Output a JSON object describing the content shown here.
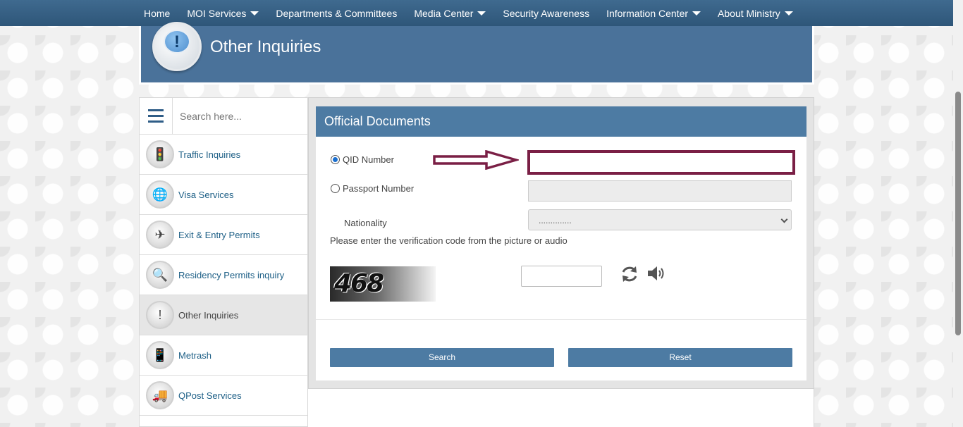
{
  "nav": {
    "items": [
      {
        "label": "Home",
        "dropdown": false
      },
      {
        "label": "MOI Services",
        "dropdown": true
      },
      {
        "label": "Departments & Committees",
        "dropdown": false
      },
      {
        "label": "Media Center",
        "dropdown": true
      },
      {
        "label": "Security Awareness",
        "dropdown": false
      },
      {
        "label": "Information Center",
        "dropdown": true
      },
      {
        "label": "About Ministry",
        "dropdown": true
      }
    ]
  },
  "banner": {
    "title": "Other Inquiries",
    "icon_glyph": "!"
  },
  "sidebar": {
    "search_placeholder": "Search here...",
    "items": [
      {
        "label": "Traffic Inquiries",
        "icon": "traffic-light-icon",
        "glyph": "🚦",
        "active": false
      },
      {
        "label": "Visa Services",
        "icon": "visa-icon",
        "glyph": "🌐",
        "active": false
      },
      {
        "label": "Exit & Entry Permits",
        "icon": "airplane-icon",
        "glyph": "✈",
        "active": false
      },
      {
        "label": "Residency Permits inquiry",
        "icon": "magnifier-icon",
        "glyph": "🔍",
        "active": false
      },
      {
        "label": "Other Inquiries",
        "icon": "exclamation-bubble-icon",
        "glyph": "!",
        "active": true
      },
      {
        "label": "Metrash",
        "icon": "phone-icon",
        "glyph": "📱",
        "active": false
      },
      {
        "label": "QPost Services",
        "icon": "delivery-van-icon",
        "glyph": "🚚",
        "active": false
      }
    ]
  },
  "form": {
    "title": "Official Documents",
    "qid_label": "QID Number",
    "passport_label": "Passport Number",
    "nationality_label": "Nationality",
    "nationality_value": "..............",
    "verification_text": "Please enter the verification code from the picture or audio",
    "captcha_text": "468",
    "search_label": "Search",
    "reset_label": "Reset",
    "selected_option": "qid"
  },
  "colors": {
    "nav_bg": "#2e5679",
    "banner_bg": "#4a729a",
    "form_header_bg": "#4d7ba3",
    "highlight": "#7a1f45"
  }
}
